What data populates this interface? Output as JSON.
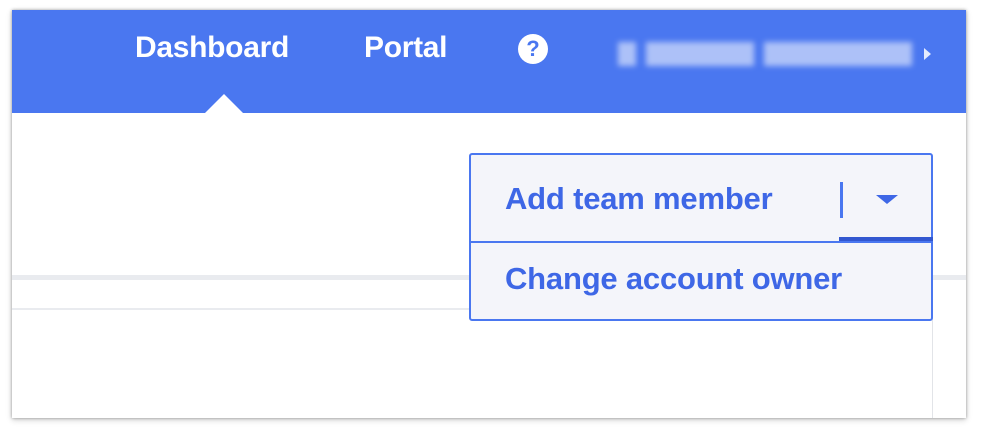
{
  "header": {
    "nav_items": [
      {
        "label": "Dashboard",
        "active": true
      },
      {
        "label": "Portal",
        "active": false
      }
    ],
    "help_icon": "question-circle-icon",
    "help_glyph": "?",
    "user_menu_icon": "caret-right-icon",
    "colors": {
      "bar": "#4a77f0",
      "text": "#ffffff"
    }
  },
  "team_actions": {
    "primary_label": "Add team member",
    "toggle_icon": "caret-down-icon",
    "menu_items": [
      {
        "label": "Change account owner"
      }
    ],
    "colors": {
      "accent": "#3e67e6",
      "background": "#f4f5fa"
    }
  }
}
